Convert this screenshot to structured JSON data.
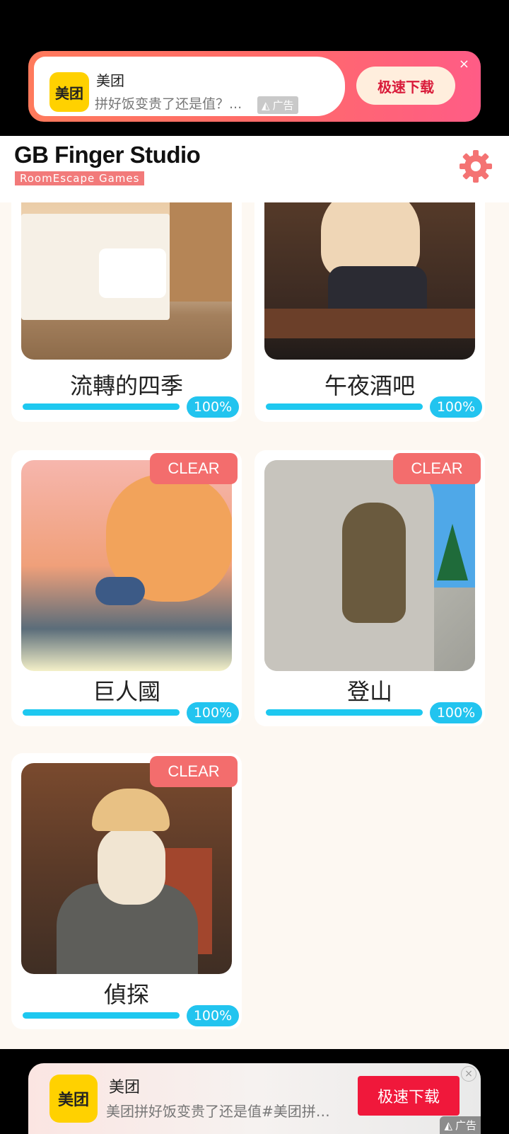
{
  "top_ad": {
    "brand_logo_text": "美团",
    "name": "美团",
    "description": "拼好饭变贵了还是值？...",
    "badge": "广告",
    "download_label": "极速下载",
    "close_glyph": "×"
  },
  "header": {
    "title": "GB Finger Studio",
    "subtitle": "RoomEscape  Games",
    "settings_icon": "gear-icon",
    "accent_color": "#f27a7a"
  },
  "games": [
    {
      "title": "流轉的四季",
      "progress": "100%",
      "clear": ""
    },
    {
      "title": "午夜酒吧",
      "progress": "100%",
      "clear": ""
    },
    {
      "title": "巨人國",
      "progress": "100%",
      "clear": "CLEAR"
    },
    {
      "title": "登山",
      "progress": "100%",
      "clear": "CLEAR"
    },
    {
      "title": "偵探",
      "progress": "100%",
      "clear": "CLEAR"
    }
  ],
  "bottom_ad": {
    "brand_logo_text": "美团",
    "name": "美团",
    "description": "美团拼好饭变贵了还是值#美团拼…",
    "badge": "广告",
    "download_label": "极速下载",
    "close_glyph": "×"
  },
  "colors": {
    "progress": "#1ec8f0",
    "clear_tag": "#f36d6d",
    "background": "#fdf8f2"
  }
}
